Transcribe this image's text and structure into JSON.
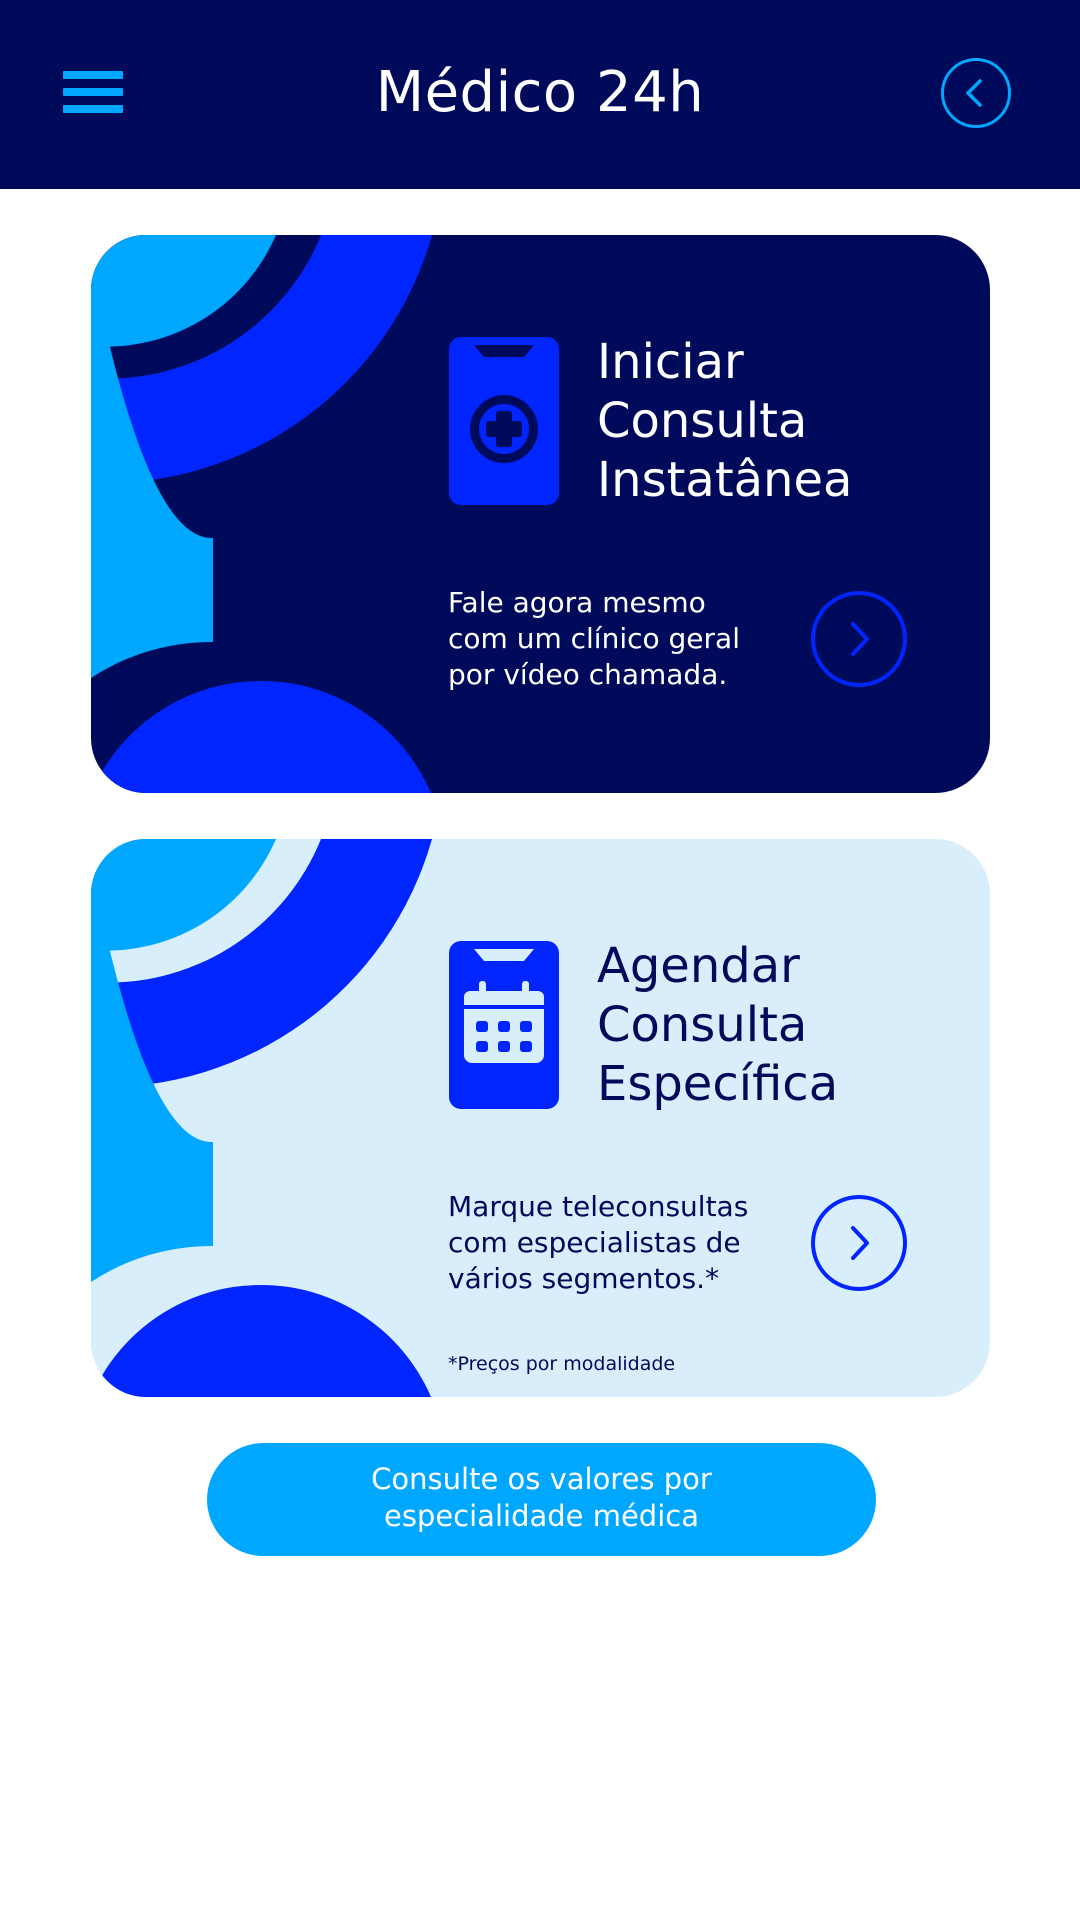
{
  "header": {
    "title": "Médico 24h",
    "menu_icon": "hamburger-menu-icon",
    "back_icon": "chevron-left-icon"
  },
  "cards": {
    "instant": {
      "title_lines": [
        "Iniciar",
        "Consulta",
        "Instatânea"
      ],
      "description_lines": [
        "Fale agora mesmo",
        "com um clínico geral",
        "por vídeo chamada."
      ],
      "icon": "phone-medical-cross-icon",
      "arrow_icon": "chevron-right-icon"
    },
    "schedule": {
      "title_lines": [
        "Agendar",
        "Consulta",
        "Específica"
      ],
      "description_lines": [
        "Marque teleconsultas",
        "com especialistas de",
        "vários segmentos.*"
      ],
      "footnote": "*Preços por modalidade",
      "icon": "phone-calendar-icon",
      "arrow_icon": "chevron-right-icon"
    }
  },
  "cta": {
    "label_lines": [
      "Consulte os valores por",
      "especialidade médica"
    ]
  },
  "colors": {
    "navy": "#000a5a",
    "royal_blue": "#0025ff",
    "sky_blue": "#00a7ff",
    "light_card": "#d8eefa",
    "white": "#ffffff"
  }
}
